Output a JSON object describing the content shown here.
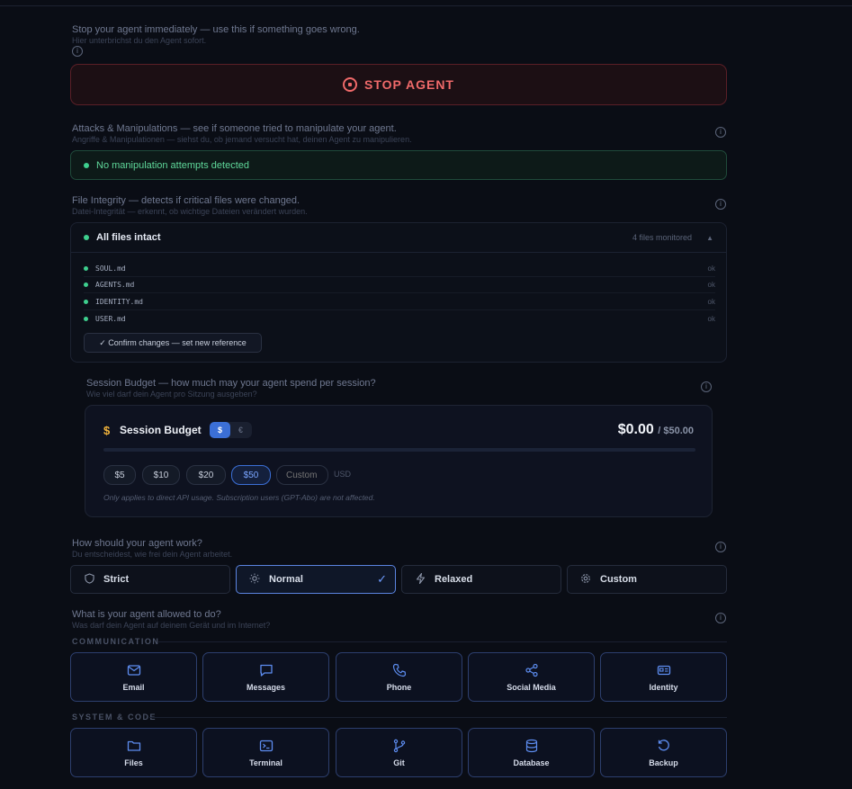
{
  "stop": {
    "title": "Stop your agent immediately — use this if something goes wrong.",
    "subtitle": "Hier unterbrichst du den Agent sofort.",
    "button_label": "STOP AGENT"
  },
  "manipulations": {
    "title": "Attacks & Manipulations — see if someone tried to manipulate your agent.",
    "subtitle": "Angriffe & Manipulationen — siehst du, ob jemand versucht hat, deinen Agent zu manipulieren.",
    "status": "No manipulation attempts detected"
  },
  "integrity": {
    "title": "File Integrity — detects if critical files were changed.",
    "subtitle": "Datei-Integrität — erkennt, ob wichtige Dateien verändert wurden.",
    "status": "All files intact",
    "count": "4 files monitored",
    "caret": "▲",
    "files": [
      {
        "name": "SOUL.md",
        "state": "ok"
      },
      {
        "name": "AGENTS.md",
        "state": "ok"
      },
      {
        "name": "IDENTITY.md",
        "state": "ok"
      },
      {
        "name": "USER.md",
        "state": "ok"
      }
    ],
    "confirm_label": "✓ Confirm changes — set new reference"
  },
  "budget": {
    "title": "Session Budget — how much may your agent spend per session?",
    "subtitle": "Wie viel darf dein Agent pro Sitzung ausgeben?",
    "card_title": "Session Budget",
    "currency_icon": "$",
    "currency_options": [
      "$",
      "€"
    ],
    "spent": "$0.00",
    "limit": "/ $50.00",
    "progress": 0,
    "presets": [
      "$5",
      "$10",
      "$20",
      "$50"
    ],
    "selected_preset": "$50",
    "custom_placeholder": "Custom",
    "unit": "USD",
    "note": "Only applies to direct API usage. Subscription users (GPT-Abo) are not affected."
  },
  "mode": {
    "title": "How should your agent work?",
    "subtitle": "Du entscheidest, wie frei dein Agent arbeitet.",
    "options": [
      {
        "label": "Strict",
        "icon": "shield-icon"
      },
      {
        "label": "Normal",
        "icon": "sun-icon",
        "selected": true
      },
      {
        "label": "Relaxed",
        "icon": "lightning-icon"
      },
      {
        "label": "Custom",
        "icon": "gear-icon"
      }
    ],
    "check": "✓"
  },
  "permissions": {
    "title": "What is your agent allowed to do?",
    "subtitle": "Was darf dein Agent auf deinem Gerät und im Internet?",
    "categories": [
      {
        "label": "COMMUNICATION",
        "items": [
          {
            "label": "Email",
            "icon": "mail-icon"
          },
          {
            "label": "Messages",
            "icon": "chat-icon"
          },
          {
            "label": "Phone",
            "icon": "phone-icon"
          },
          {
            "label": "Social Media",
            "icon": "share-icon"
          },
          {
            "label": "Identity",
            "icon": "id-card-icon"
          }
        ]
      },
      {
        "label": "SYSTEM & CODE",
        "items": [
          {
            "label": "Files",
            "icon": "folder-icon"
          },
          {
            "label": "Terminal",
            "icon": "terminal-icon"
          },
          {
            "label": "Git",
            "icon": "git-branch-icon"
          },
          {
            "label": "Database",
            "icon": "database-icon"
          },
          {
            "label": "Backup",
            "icon": "restore-icon"
          }
        ]
      }
    ]
  },
  "colors": {
    "background": "#0a0d15",
    "danger": "#f06a6a",
    "success": "#3ecf8e",
    "accent": "#3b6fd6",
    "budget_icon": "#f2b43c"
  }
}
